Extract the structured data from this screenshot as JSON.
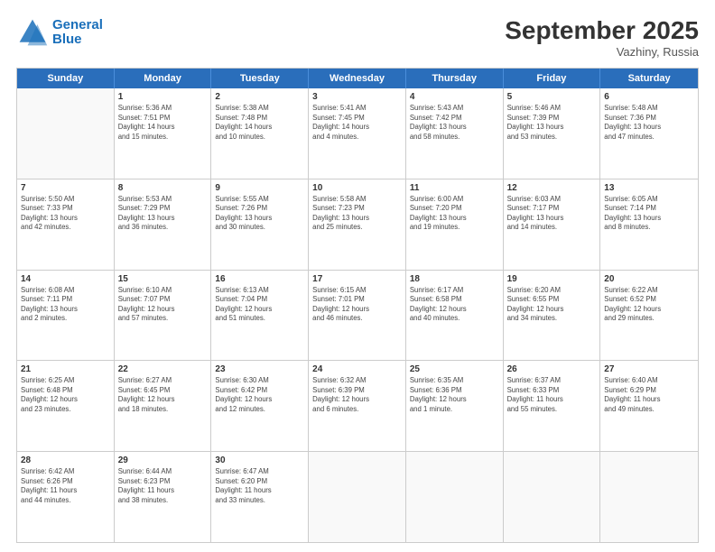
{
  "header": {
    "logo_line1": "General",
    "logo_line2": "Blue",
    "month": "September 2025",
    "location": "Vazhiny, Russia"
  },
  "weekdays": [
    "Sunday",
    "Monday",
    "Tuesday",
    "Wednesday",
    "Thursday",
    "Friday",
    "Saturday"
  ],
  "weeks": [
    [
      {
        "day": "",
        "info": ""
      },
      {
        "day": "1",
        "info": "Sunrise: 5:36 AM\nSunset: 7:51 PM\nDaylight: 14 hours\nand 15 minutes."
      },
      {
        "day": "2",
        "info": "Sunrise: 5:38 AM\nSunset: 7:48 PM\nDaylight: 14 hours\nand 10 minutes."
      },
      {
        "day": "3",
        "info": "Sunrise: 5:41 AM\nSunset: 7:45 PM\nDaylight: 14 hours\nand 4 minutes."
      },
      {
        "day": "4",
        "info": "Sunrise: 5:43 AM\nSunset: 7:42 PM\nDaylight: 13 hours\nand 58 minutes."
      },
      {
        "day": "5",
        "info": "Sunrise: 5:46 AM\nSunset: 7:39 PM\nDaylight: 13 hours\nand 53 minutes."
      },
      {
        "day": "6",
        "info": "Sunrise: 5:48 AM\nSunset: 7:36 PM\nDaylight: 13 hours\nand 47 minutes."
      }
    ],
    [
      {
        "day": "7",
        "info": "Sunrise: 5:50 AM\nSunset: 7:33 PM\nDaylight: 13 hours\nand 42 minutes."
      },
      {
        "day": "8",
        "info": "Sunrise: 5:53 AM\nSunset: 7:29 PM\nDaylight: 13 hours\nand 36 minutes."
      },
      {
        "day": "9",
        "info": "Sunrise: 5:55 AM\nSunset: 7:26 PM\nDaylight: 13 hours\nand 30 minutes."
      },
      {
        "day": "10",
        "info": "Sunrise: 5:58 AM\nSunset: 7:23 PM\nDaylight: 13 hours\nand 25 minutes."
      },
      {
        "day": "11",
        "info": "Sunrise: 6:00 AM\nSunset: 7:20 PM\nDaylight: 13 hours\nand 19 minutes."
      },
      {
        "day": "12",
        "info": "Sunrise: 6:03 AM\nSunset: 7:17 PM\nDaylight: 13 hours\nand 14 minutes."
      },
      {
        "day": "13",
        "info": "Sunrise: 6:05 AM\nSunset: 7:14 PM\nDaylight: 13 hours\nand 8 minutes."
      }
    ],
    [
      {
        "day": "14",
        "info": "Sunrise: 6:08 AM\nSunset: 7:11 PM\nDaylight: 13 hours\nand 2 minutes."
      },
      {
        "day": "15",
        "info": "Sunrise: 6:10 AM\nSunset: 7:07 PM\nDaylight: 12 hours\nand 57 minutes."
      },
      {
        "day": "16",
        "info": "Sunrise: 6:13 AM\nSunset: 7:04 PM\nDaylight: 12 hours\nand 51 minutes."
      },
      {
        "day": "17",
        "info": "Sunrise: 6:15 AM\nSunset: 7:01 PM\nDaylight: 12 hours\nand 46 minutes."
      },
      {
        "day": "18",
        "info": "Sunrise: 6:17 AM\nSunset: 6:58 PM\nDaylight: 12 hours\nand 40 minutes."
      },
      {
        "day": "19",
        "info": "Sunrise: 6:20 AM\nSunset: 6:55 PM\nDaylight: 12 hours\nand 34 minutes."
      },
      {
        "day": "20",
        "info": "Sunrise: 6:22 AM\nSunset: 6:52 PM\nDaylight: 12 hours\nand 29 minutes."
      }
    ],
    [
      {
        "day": "21",
        "info": "Sunrise: 6:25 AM\nSunset: 6:48 PM\nDaylight: 12 hours\nand 23 minutes."
      },
      {
        "day": "22",
        "info": "Sunrise: 6:27 AM\nSunset: 6:45 PM\nDaylight: 12 hours\nand 18 minutes."
      },
      {
        "day": "23",
        "info": "Sunrise: 6:30 AM\nSunset: 6:42 PM\nDaylight: 12 hours\nand 12 minutes."
      },
      {
        "day": "24",
        "info": "Sunrise: 6:32 AM\nSunset: 6:39 PM\nDaylight: 12 hours\nand 6 minutes."
      },
      {
        "day": "25",
        "info": "Sunrise: 6:35 AM\nSunset: 6:36 PM\nDaylight: 12 hours\nand 1 minute."
      },
      {
        "day": "26",
        "info": "Sunrise: 6:37 AM\nSunset: 6:33 PM\nDaylight: 11 hours\nand 55 minutes."
      },
      {
        "day": "27",
        "info": "Sunrise: 6:40 AM\nSunset: 6:29 PM\nDaylight: 11 hours\nand 49 minutes."
      }
    ],
    [
      {
        "day": "28",
        "info": "Sunrise: 6:42 AM\nSunset: 6:26 PM\nDaylight: 11 hours\nand 44 minutes."
      },
      {
        "day": "29",
        "info": "Sunrise: 6:44 AM\nSunset: 6:23 PM\nDaylight: 11 hours\nand 38 minutes."
      },
      {
        "day": "30",
        "info": "Sunrise: 6:47 AM\nSunset: 6:20 PM\nDaylight: 11 hours\nand 33 minutes."
      },
      {
        "day": "",
        "info": ""
      },
      {
        "day": "",
        "info": ""
      },
      {
        "day": "",
        "info": ""
      },
      {
        "day": "",
        "info": ""
      }
    ]
  ]
}
